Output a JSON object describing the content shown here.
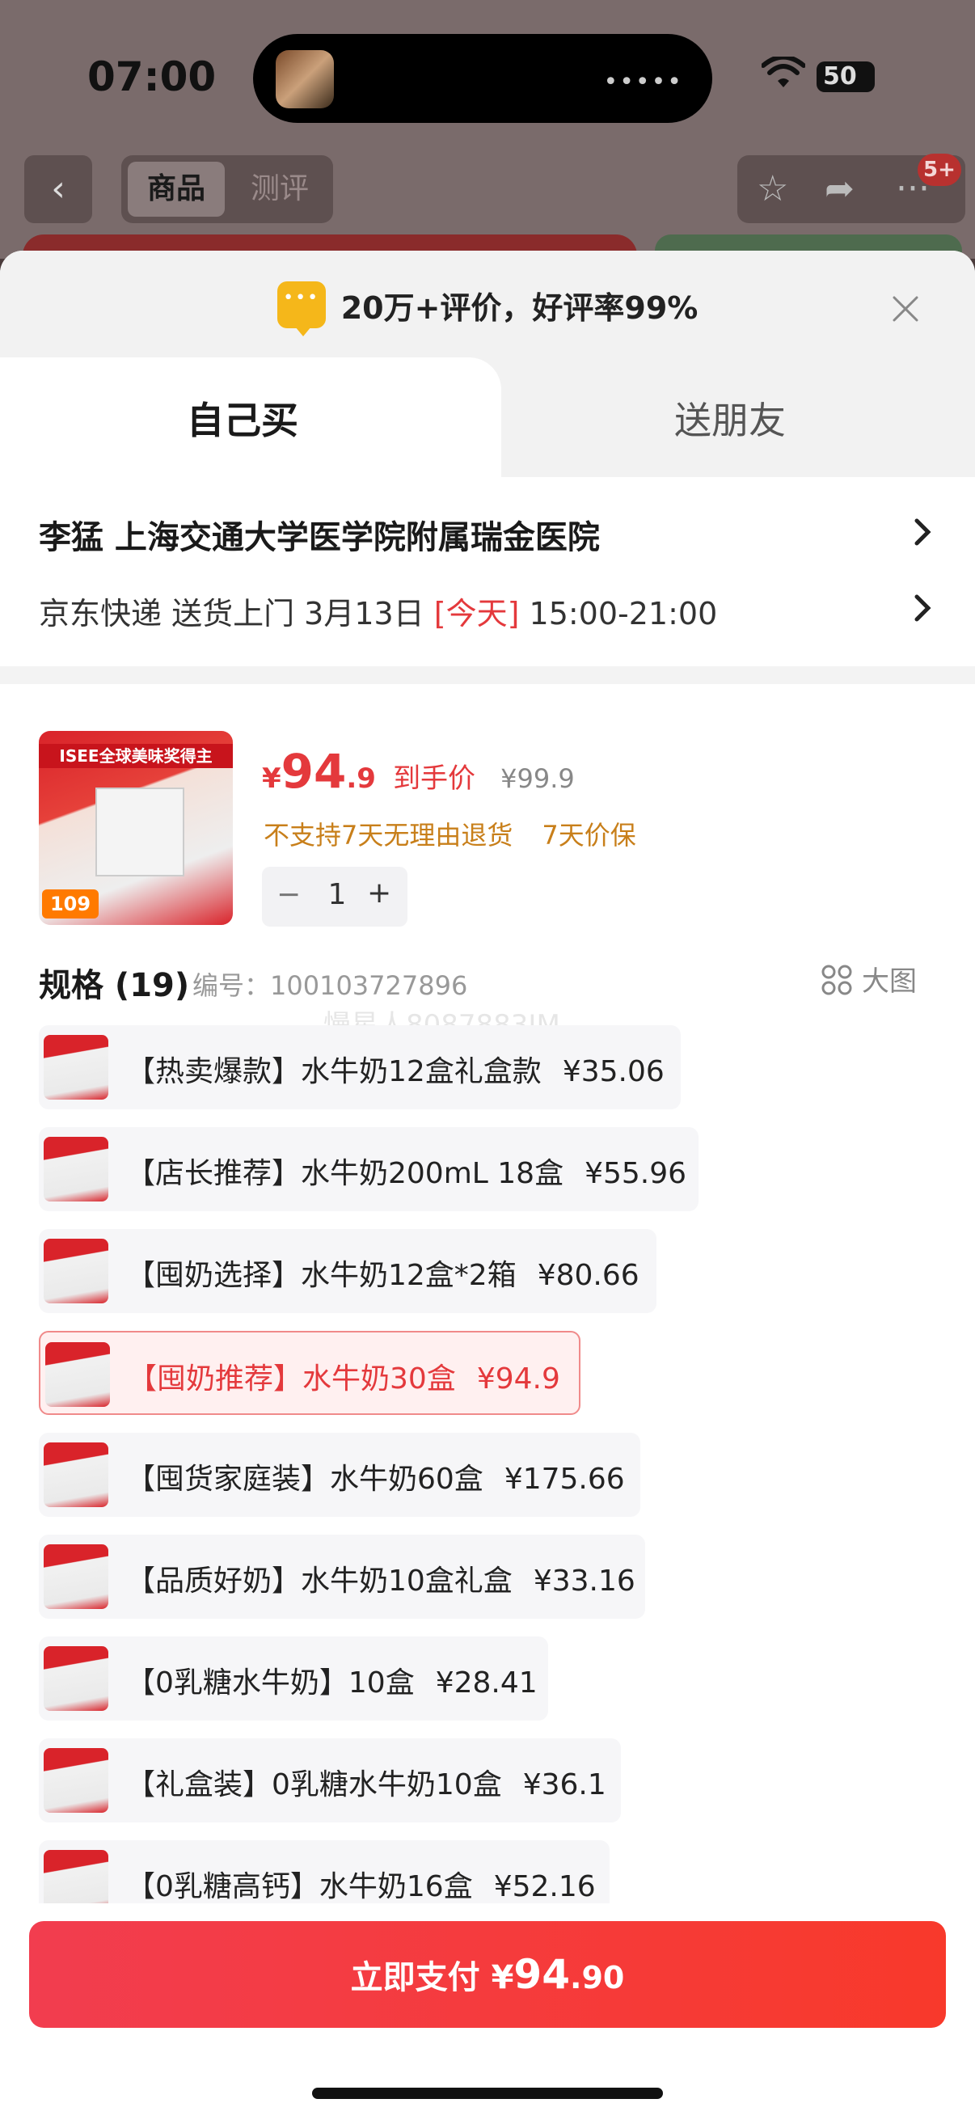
{
  "status_bar": {
    "time": "07:00",
    "battery": "50"
  },
  "nav": {
    "back_icon": "chevron-left-icon",
    "segments": [
      "商品",
      "测评"
    ],
    "cart_badge": "5+"
  },
  "sheet": {
    "review_summary": "20万+评价，好评率99%",
    "tabs": [
      "自己买",
      "送朋友"
    ],
    "address": "李猛  上海交通大学医学院附属瑞金医院",
    "delivery": {
      "prefix": "京东快递 送货上门 3月13日 ",
      "today": "[今天]",
      "window": " 15:00-21:00"
    },
    "product": {
      "price_symbol": "¥",
      "price_int": "94",
      "price_dec": ".9",
      "price_label": "到手价",
      "original_price": "¥99.9",
      "tags": [
        "不支持7天无理由退货",
        "7天价保"
      ],
      "quantity": "1",
      "image_band_text": "ISEE全球美味奖得主",
      "image_price_tag": "109"
    },
    "spec": {
      "title": "规格 (19)",
      "code": "编号：100103727896",
      "big_image_label": "大图",
      "watermark": "慢星人8087883JM"
    },
    "options": [
      {
        "label": "【热卖爆款】水牛奶12盒礼盒款",
        "price": "¥35.06",
        "selected": false
      },
      {
        "label": "【店长推荐】水牛奶200mL 18盒",
        "price": "¥55.96",
        "selected": false
      },
      {
        "label": "【囤奶选择】水牛奶12盒*2箱",
        "price": "¥80.66",
        "selected": false
      },
      {
        "label": "【囤奶推荐】水牛奶30盒",
        "price": "¥94.9",
        "selected": true
      },
      {
        "label": "【囤货家庭装】水牛奶60盒",
        "price": "¥175.66",
        "selected": false
      },
      {
        "label": "【品质好奶】水牛奶10盒礼盒",
        "price": "¥33.16",
        "selected": false
      },
      {
        "label": "【0乳糖水牛奶】10盒",
        "price": "¥28.41",
        "selected": false
      },
      {
        "label": "【礼盒装】0乳糖水牛奶10盒",
        "price": "¥36.1",
        "selected": false
      },
      {
        "label": "【0乳糖高钙】水牛奶16盒",
        "price": "¥52.16",
        "selected": false
      }
    ],
    "pay_button": {
      "label": "立即支付 ",
      "symbol": "¥",
      "amount": "94",
      "decimal": ".90"
    }
  },
  "colors": {
    "accent": "#e4393c",
    "tag": "#c87f1a",
    "review_icon": "#f5b71a"
  }
}
